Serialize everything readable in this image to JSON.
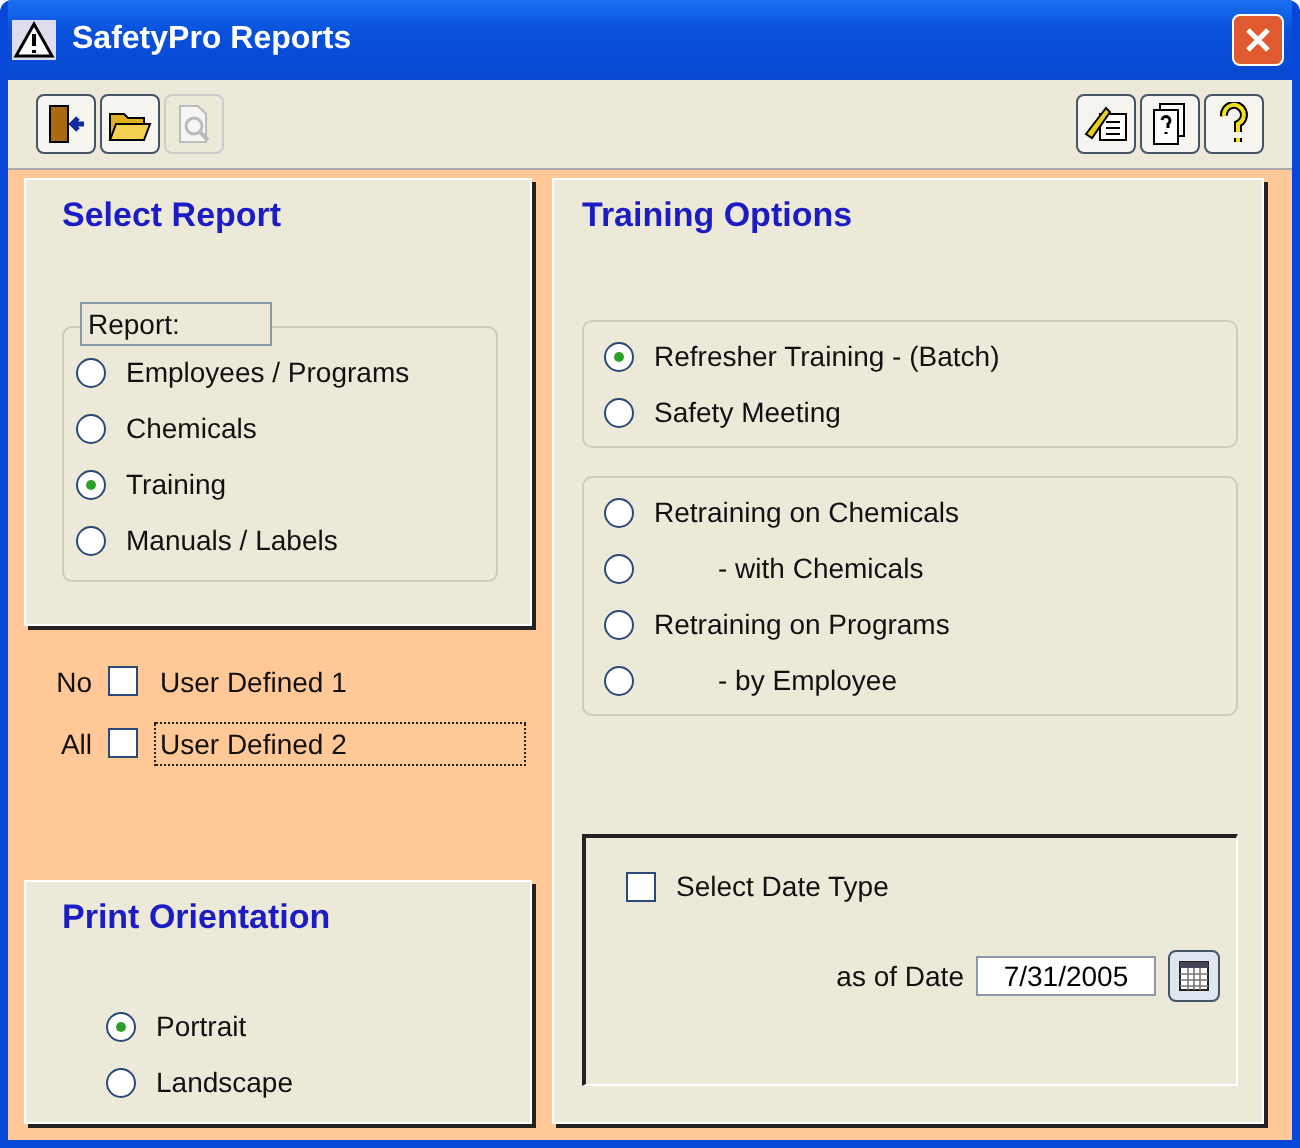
{
  "window": {
    "title": "SafetyPro Reports"
  },
  "toolbar": {
    "left": [
      {
        "kind": "exit",
        "disabled": false
      },
      {
        "kind": "open",
        "disabled": false
      },
      {
        "kind": "preview",
        "disabled": true
      }
    ],
    "right": [
      {
        "kind": "setup",
        "disabled": false
      },
      {
        "kind": "help-doc",
        "disabled": false
      },
      {
        "kind": "help",
        "disabled": false
      }
    ]
  },
  "select_report": {
    "title": "Select Report",
    "group_label": "Report:",
    "options": [
      {
        "label": "Employees / Programs",
        "selected": false
      },
      {
        "label": "Chemicals",
        "selected": false
      },
      {
        "label": "Training",
        "selected": true
      },
      {
        "label": "Manuals / Labels",
        "selected": false
      }
    ]
  },
  "user_defined": [
    {
      "prefix": "No",
      "label": "User Defined 1",
      "checked": false,
      "focused": false
    },
    {
      "prefix": "All",
      "label": "User Defined 2",
      "checked": false,
      "focused": true
    }
  ],
  "print_orientation": {
    "title": "Print Orientation",
    "options": [
      {
        "label": "Portrait",
        "selected": true
      },
      {
        "label": "Landscape",
        "selected": false
      }
    ]
  },
  "training_options": {
    "title": "Training Options",
    "groups": [
      [
        {
          "label": "Refresher Training - (Batch)",
          "kind": "main",
          "selected": true
        },
        {
          "label": "Safety Meeting",
          "kind": "main",
          "selected": false
        }
      ],
      [
        {
          "label": "Retraining on Chemicals",
          "kind": "main",
          "selected": false
        },
        {
          "label": "- with Chemicals",
          "kind": "sub",
          "selected": false
        },
        {
          "label": "Retraining on Programs",
          "kind": "main",
          "selected": false
        },
        {
          "label": "- by Employee",
          "kind": "sub",
          "selected": false
        }
      ]
    ]
  },
  "date": {
    "select_date_type": {
      "label": "Select Date Type",
      "checked": false
    },
    "as_of_label": "as of Date",
    "value": "7/31/2005"
  }
}
